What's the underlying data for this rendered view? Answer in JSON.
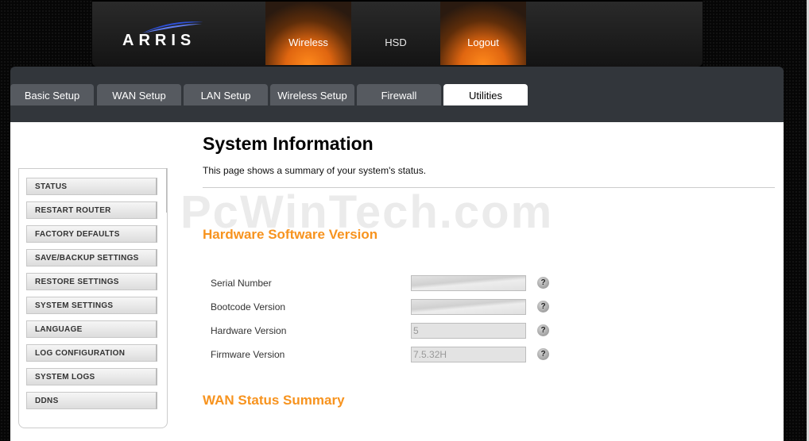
{
  "brand": {
    "logo_text": "ARRIS"
  },
  "top_nav": {
    "items": [
      "Wireless",
      "HSD",
      "Logout"
    ]
  },
  "sub_tabs": [
    "Basic Setup",
    "WAN Setup",
    "LAN Setup",
    "Wireless Setup",
    "Firewall",
    "Utilities"
  ],
  "active_sub_tab": "Utilities",
  "sidebar": {
    "items": [
      "STATUS",
      "RESTART ROUTER",
      "FACTORY DEFAULTS",
      "SAVE/BACKUP SETTINGS",
      "RESTORE SETTINGS",
      "SYSTEM SETTINGS",
      "LANGUAGE",
      "LOG CONFIGURATION",
      "SYSTEM LOGS",
      "DDNS"
    ]
  },
  "main": {
    "title": "System Information",
    "description": "This page shows a summary of your system's status.",
    "watermark": "PcWinTech.com",
    "hw_section": {
      "title": "Hardware Software Version",
      "fields": [
        {
          "label": "Serial Number",
          "value": ""
        },
        {
          "label": "Bootcode Version",
          "value": ""
        },
        {
          "label": "Hardware Version",
          "value": "5"
        },
        {
          "label": "Firmware Version",
          "value": "7.5.32H"
        }
      ]
    },
    "wan_section": {
      "title": "WAN Status Summary"
    },
    "help_glyph": "?"
  },
  "colors": {
    "accent": "#f7931e",
    "panel": "#32363b",
    "tab": "#565a60"
  }
}
